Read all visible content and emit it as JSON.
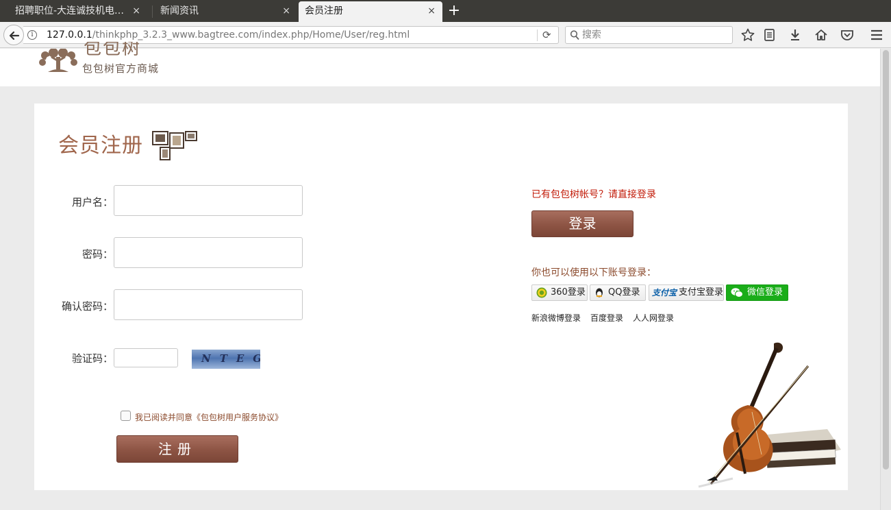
{
  "browser": {
    "tabs": [
      {
        "title": "招聘职位-大连诚技机电…",
        "close": "×"
      },
      {
        "title": "新闻资讯",
        "close": "×"
      },
      {
        "title": "会员注册",
        "close": "×"
      }
    ],
    "new_tab": "+",
    "url_host": "127.0.0.1",
    "url_path": "/thinkphp_3.2.3_www.bagtree.com/index.php/Home/User/reg.html",
    "search_placeholder": "搜索",
    "icons": [
      "back-icon",
      "info-icon",
      "reload-icon",
      "search-icon",
      "bookmark-star-icon",
      "reading-list-icon",
      "download-icon",
      "home-icon",
      "pocket-icon",
      "menu-icon"
    ]
  },
  "header": {
    "brand": "包包树",
    "subtitle": "包包树官方商城"
  },
  "register": {
    "title": "会员注册",
    "username_label": "用户名：",
    "password_label": "密码：",
    "confirm_label": "确认密码：",
    "captcha_label": "验证码：",
    "captcha_text": "NTEG",
    "agree_text": "我已阅读并同意《包包树用户服务协议》",
    "submit_label": "注册"
  },
  "login": {
    "prompt": "已有包包树帐号？请直接登录",
    "button": "登录",
    "other_prompt": "你也可以使用以下账号登录：",
    "providers": [
      {
        "label": "360登录",
        "icon": "360-icon"
      },
      {
        "label": "QQ登录",
        "icon": "qq-penguin-icon"
      },
      {
        "label": "支付宝登录",
        "logo_text": "支付宝",
        "icon": "alipay-icon"
      },
      {
        "label": "微信登录",
        "icon": "wechat-icon"
      }
    ],
    "text_links": [
      "新浪微博登录",
      "百度登录",
      "人人网登录"
    ]
  },
  "colors": {
    "accent_brown": "#8d5444",
    "title_brown": "#a0664c",
    "alert_red": "#c21b08",
    "wechat_green": "#1aad19"
  }
}
